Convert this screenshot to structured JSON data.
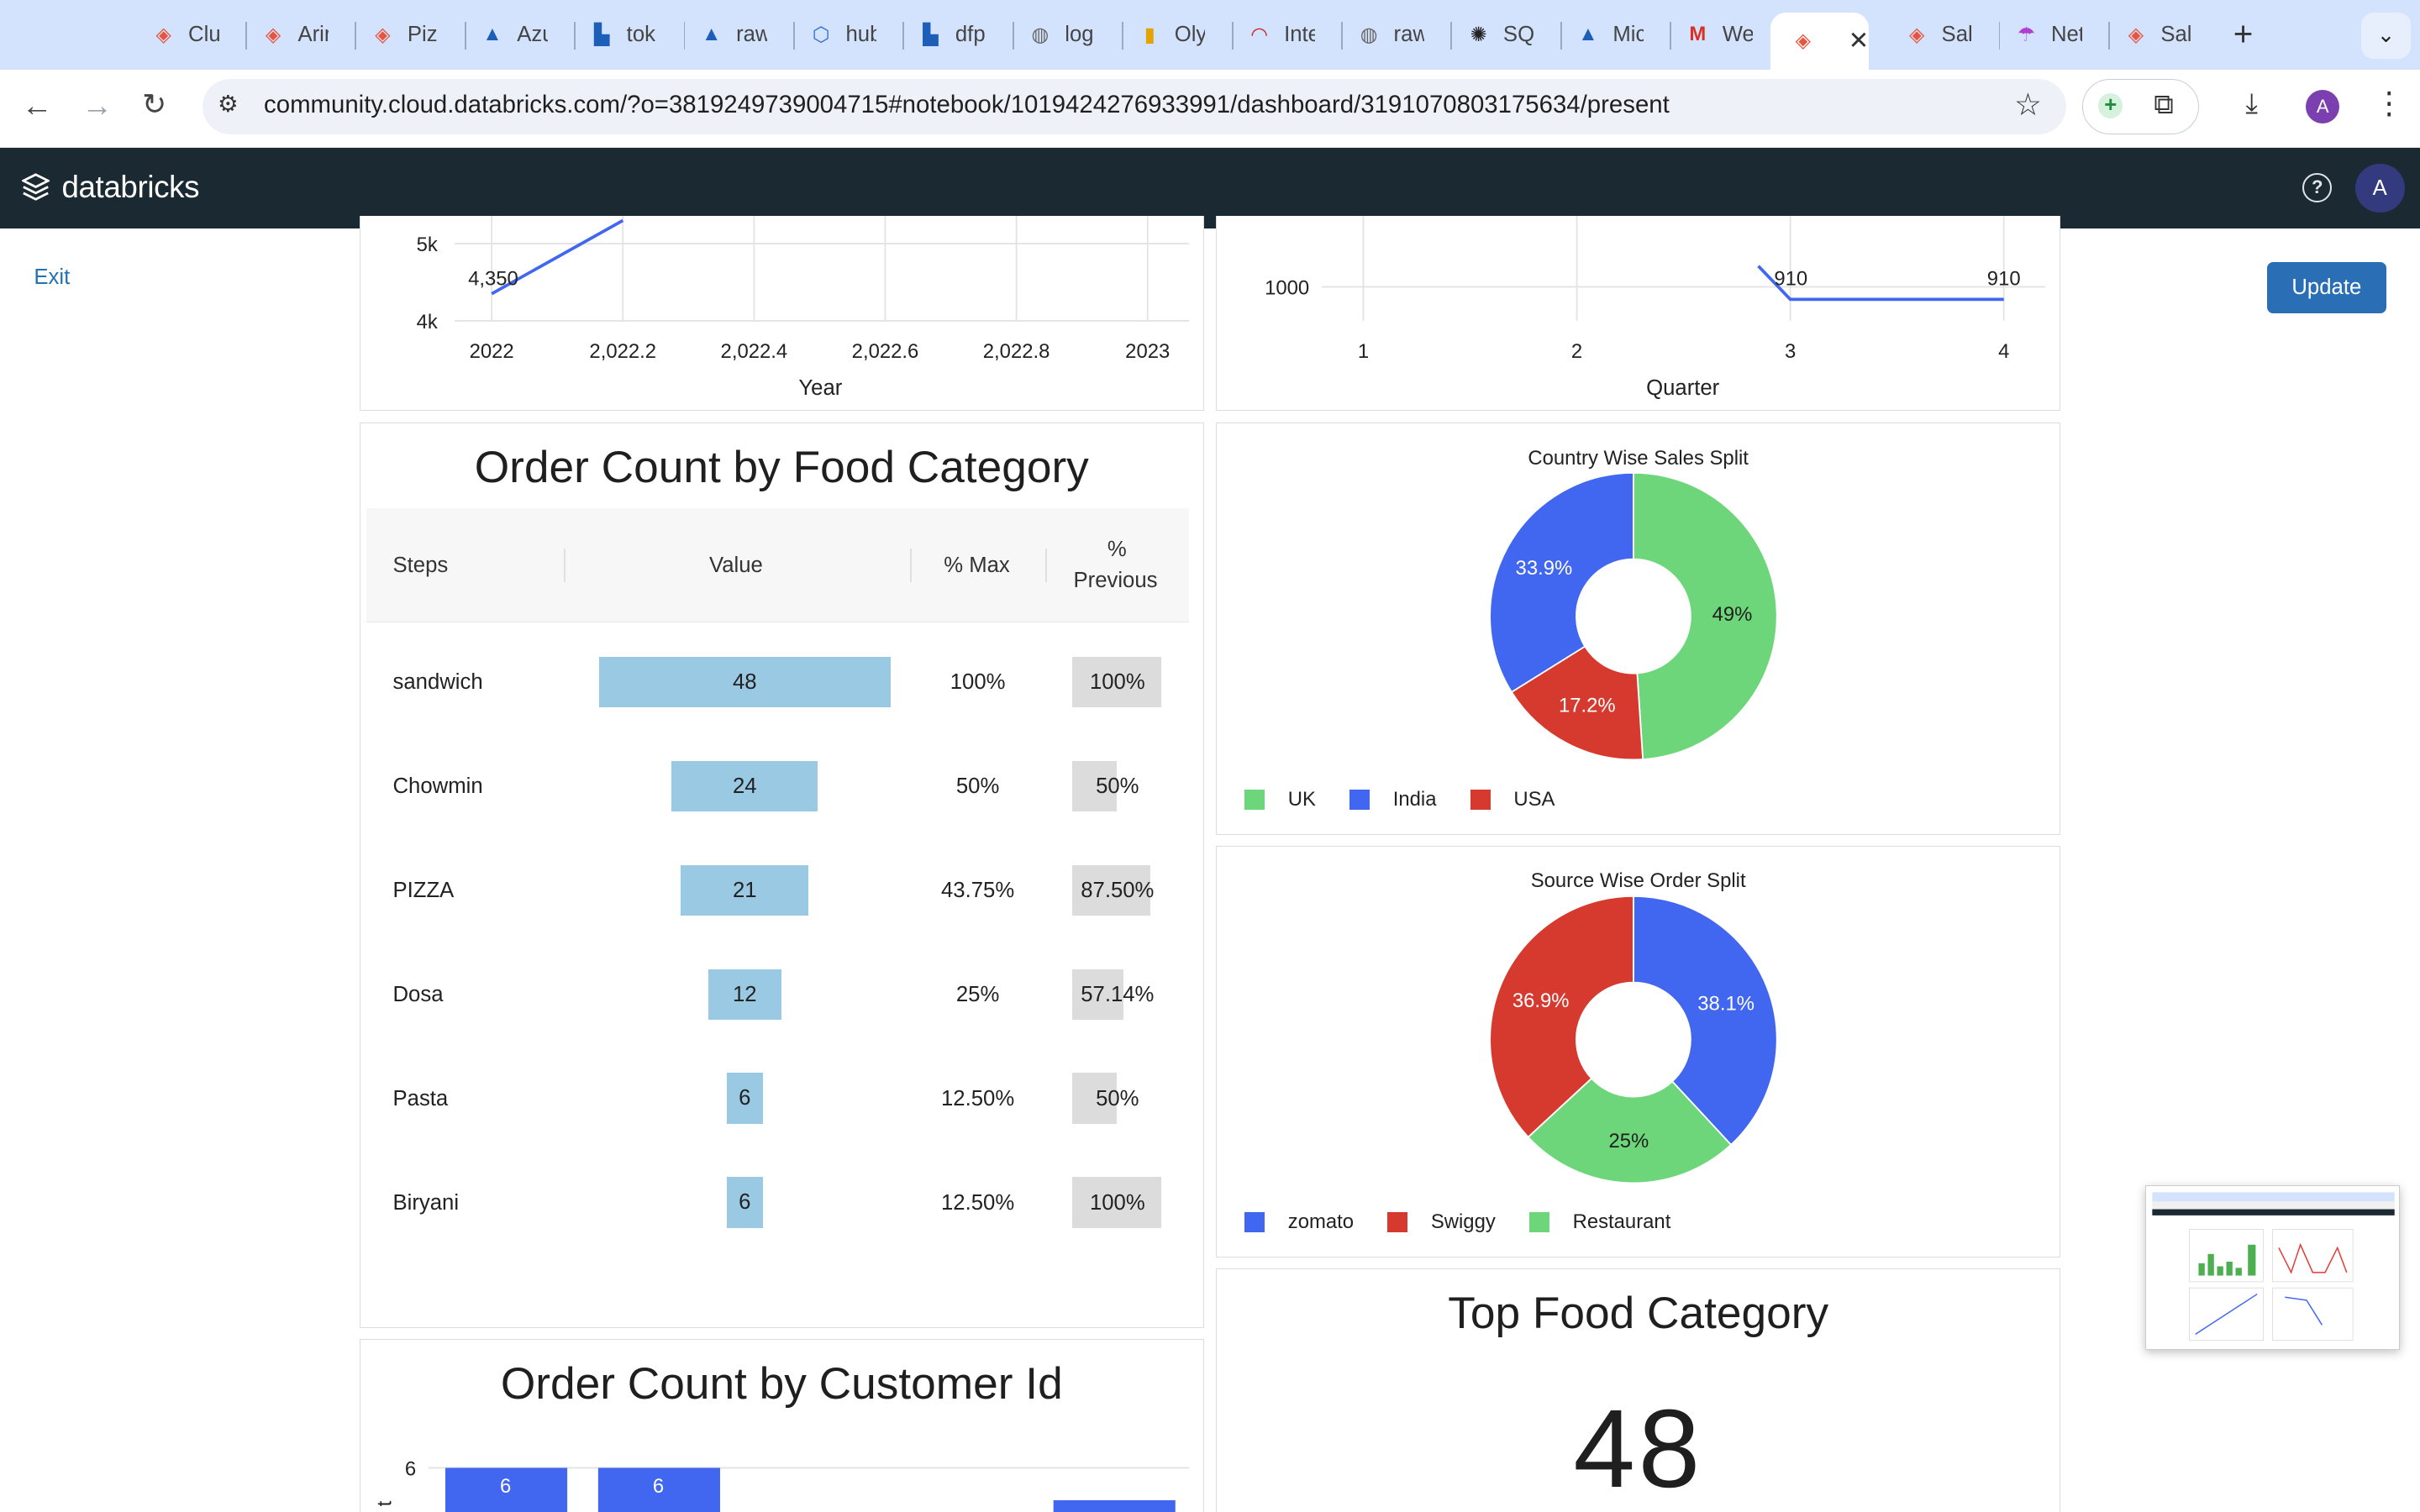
{
  "browser": {
    "tabs": [
      {
        "title": "Clu",
        "icon": "databricks-icon"
      },
      {
        "title": "Arir",
        "icon": "databricks-icon"
      },
      {
        "title": "Piz",
        "icon": "databricks-icon"
      },
      {
        "title": "Azu",
        "icon": "azure-icon"
      },
      {
        "title": "tok",
        "icon": "factory-icon"
      },
      {
        "title": "raw",
        "icon": "azure-icon"
      },
      {
        "title": "hub",
        "icon": "hub-icon"
      },
      {
        "title": "dfp",
        "icon": "factory-icon"
      },
      {
        "title": "log",
        "icon": "globe-icon"
      },
      {
        "title": "Oly",
        "icon": "chart-icon"
      },
      {
        "title": "Inte",
        "icon": "gauge-icon"
      },
      {
        "title": "raw",
        "icon": "globe-icon"
      },
      {
        "title": "SQ",
        "icon": "openai-icon"
      },
      {
        "title": "Mic",
        "icon": "azure-icon"
      },
      {
        "title": "We",
        "icon": "gmail-icon"
      },
      {
        "title": "",
        "icon": "databricks-icon",
        "active": true
      },
      {
        "title": "Sal",
        "icon": "databricks-icon"
      },
      {
        "title": "Net",
        "icon": "umbrella-icon"
      },
      {
        "title": "Sal",
        "icon": "databricks-icon"
      }
    ],
    "url": "community.cloud.databricks.com/?o=3819249739004715#notebook/1019424276933991/dashboard/3191070803175634/present",
    "profile_initial": "A"
  },
  "app": {
    "logo_text": "databricks",
    "help_icon": "question-circle-icon",
    "user_initial": "A",
    "exit_label": "Exit",
    "update_label": "Update"
  },
  "colors": {
    "blue": "#4166f0",
    "green": "#6dd67a",
    "red": "#d63a2f",
    "funnel_bar": "#9ac9e3",
    "appbar": "#1b2a32"
  },
  "yearly_chart": {
    "y_ticks": [
      "5k",
      "4k"
    ],
    "x_ticks": [
      "2022",
      "2,022.2",
      "2,022.4",
      "2,022.6",
      "2,022.8",
      "2023"
    ],
    "x_label": "Year",
    "point_label": "4,350"
  },
  "quarterly_chart": {
    "y_tick": "1000",
    "x_ticks": [
      "1",
      "2",
      "3",
      "4"
    ],
    "x_label": "Quarter",
    "point_labels": [
      "910",
      "910"
    ]
  },
  "funnel": {
    "title": "Order Count by Food Category",
    "headers": {
      "steps": "Steps",
      "value": "Value",
      "pct_max": "% Max",
      "pct_prev_1": "%",
      "pct_prev_2": "Previous"
    },
    "rows": [
      {
        "step": "sandwich",
        "value": "48",
        "pct_max": "100%",
        "pct_prev": "100%"
      },
      {
        "step": "Chowmin",
        "value": "24",
        "pct_max": "50%",
        "pct_prev": "50%"
      },
      {
        "step": "PIZZA",
        "value": "21",
        "pct_max": "43.75%",
        "pct_prev": "87.50%"
      },
      {
        "step": "Dosa",
        "value": "12",
        "pct_max": "25%",
        "pct_prev": "57.14%"
      },
      {
        "step": "Pasta",
        "value": "6",
        "pct_max": "12.50%",
        "pct_prev": "50%"
      },
      {
        "step": "Biryani",
        "value": "6",
        "pct_max": "12.50%",
        "pct_prev": "100%"
      }
    ]
  },
  "country_chart": {
    "title": "Country Wise Sales Split",
    "slice_labels": [
      "49%",
      "17.2%",
      "33.9%"
    ],
    "legend": [
      "UK",
      "India",
      "USA"
    ]
  },
  "source_chart": {
    "title": "Source Wise Order Split",
    "slice_labels": [
      "38.1%",
      "25%",
      "36.9%"
    ],
    "legend": [
      "zomato",
      "Swiggy",
      "Restaurant"
    ]
  },
  "customer_chart": {
    "title": "Order Count by Customer Id",
    "y_tick": "6",
    "bar_labels": [
      "6",
      "6"
    ]
  },
  "top_food": {
    "title": "Top Food Category",
    "value": "48"
  },
  "chart_data": [
    {
      "type": "line",
      "xlabel": "Year",
      "x": [
        2022,
        2022.2
      ],
      "series": [
        {
          "values": [
            4350,
            5300
          ]
        }
      ],
      "note_label": "4,350"
    },
    {
      "type": "line",
      "xlabel": "Quarter",
      "x": [
        2.85,
        3,
        4
      ],
      "series": [
        {
          "values": [
            1150,
            910,
            910
          ]
        }
      ]
    },
    {
      "type": "pie",
      "title": "Country Wise Sales Split",
      "categories": [
        "UK",
        "India",
        "USA"
      ],
      "values": [
        49,
        33.9,
        17.2
      ]
    },
    {
      "type": "pie",
      "title": "Source Wise Order Split",
      "categories": [
        "zomato",
        "Swiggy",
        "Restaurant"
      ],
      "values": [
        38.1,
        36.9,
        25
      ]
    },
    {
      "type": "bar",
      "title": "Order Count by Customer Id",
      "values": [
        6,
        6
      ]
    },
    {
      "type": "table",
      "title": "Order Count by Food Category",
      "categories": [
        "sandwich",
        "Chowmin",
        "PIZZA",
        "Dosa",
        "Pasta",
        "Biryani"
      ],
      "values": [
        48,
        24,
        21,
        12,
        6,
        6
      ]
    }
  ]
}
